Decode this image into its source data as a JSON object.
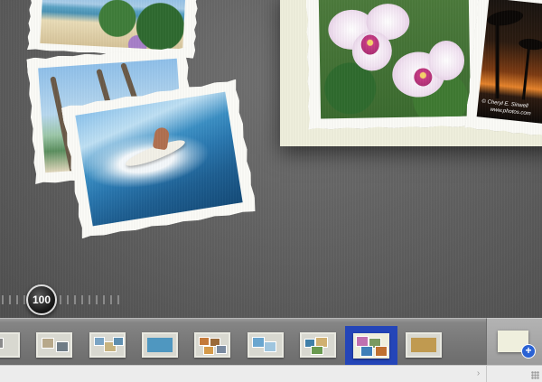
{
  "zoom": {
    "value": "100"
  },
  "album": {
    "orchid_caption": "© Cheryl E. Sinwell",
    "orchid_credit": "www.photos.com"
  },
  "filmstrip": {
    "thumbnails": [
      {
        "name": "page-1"
      },
      {
        "name": "page-2"
      },
      {
        "name": "page-3"
      },
      {
        "name": "page-4"
      },
      {
        "name": "page-5"
      },
      {
        "name": "page-6"
      },
      {
        "name": "page-7"
      },
      {
        "name": "page-8"
      },
      {
        "name": "page-9"
      }
    ],
    "selected_index": 7,
    "add_page_symbol": "+"
  },
  "scrollbar": {
    "arrow": "›"
  },
  "colors": {
    "selection": "#2445b8",
    "add_accent": "#2a62d4"
  }
}
